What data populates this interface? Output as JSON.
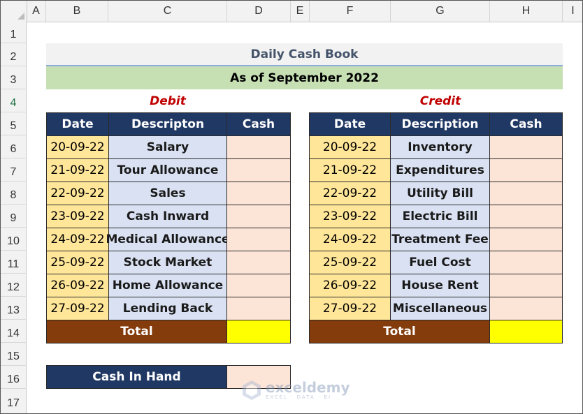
{
  "sheet": {
    "columns": [
      "A",
      "B",
      "C",
      "D",
      "E",
      "F",
      "G",
      "H",
      "I"
    ],
    "rows": [
      "1",
      "2",
      "3",
      "4",
      "5",
      "6",
      "7",
      "8",
      "9",
      "10",
      "11",
      "12",
      "13",
      "14",
      "15",
      "16",
      "17"
    ],
    "active_row": "4"
  },
  "title": "Daily Cash Book",
  "subtitle": "As of September 2022",
  "debit": {
    "label": "Debit",
    "headers": [
      "Date",
      "Descripton",
      "Cash"
    ],
    "rows": [
      {
        "date": "20-09-22",
        "desc": "Salary"
      },
      {
        "date": "21-09-22",
        "desc": "Tour Allowance"
      },
      {
        "date": "22-09-22",
        "desc": "Sales"
      },
      {
        "date": "23-09-22",
        "desc": "Cash Inward"
      },
      {
        "date": "24-09-22",
        "desc": "Medical Allowance"
      },
      {
        "date": "25-09-22",
        "desc": "Stock Market"
      },
      {
        "date": "26-09-22",
        "desc": "Home Allowance"
      },
      {
        "date": "27-09-22",
        "desc": "Lending Back"
      }
    ],
    "total_label": "Total"
  },
  "credit": {
    "label": "Credit",
    "headers": [
      "Date",
      "Description",
      "Cash"
    ],
    "rows": [
      {
        "date": "20-09-22",
        "desc": "Inventory"
      },
      {
        "date": "21-09-22",
        "desc": "Expenditures"
      },
      {
        "date": "22-09-22",
        "desc": "Utility Bill"
      },
      {
        "date": "23-09-22",
        "desc": "Electric Bill"
      },
      {
        "date": "24-09-22",
        "desc": "Treatment Fee"
      },
      {
        "date": "25-09-22",
        "desc": "Fuel Cost"
      },
      {
        "date": "26-09-22",
        "desc": "House Rent"
      },
      {
        "date": "27-09-22",
        "desc": "Miscellaneous"
      }
    ],
    "total_label": "Total"
  },
  "cash_in_hand": {
    "label": "Cash In Hand"
  },
  "watermark": {
    "name": "exceldemy",
    "tagline": "EXCEL · DATA · BI"
  },
  "colors": {
    "header_fill": "#203864",
    "date_fill": "#ffe699",
    "desc_fill": "#d9e1f2",
    "cash_fill": "#fce4d6",
    "total_fill": "#843c0c",
    "total_value_fill": "#ffff00",
    "subtitle_fill": "#c6e0b4",
    "section_label_color": "#c00000"
  }
}
